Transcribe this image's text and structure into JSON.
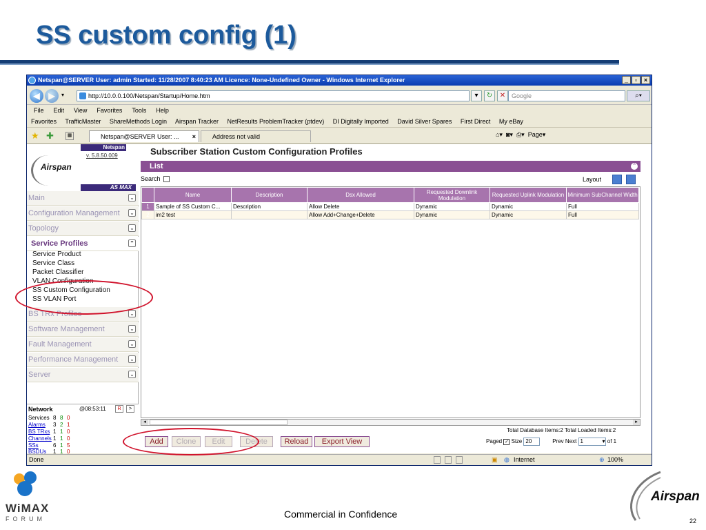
{
  "slide": {
    "title": "SS custom config (1)",
    "footer": "Commercial in Confidence",
    "page_number": "22",
    "wimax_logo_text": "WiMAX",
    "wimax_logo_sub": "FORUM",
    "airspan_logo_text": "Airspan"
  },
  "browser": {
    "title": "Netspan@SERVER User: admin Started: 11/28/2007 8:40:23 AM Licence: None-Undefined Owner - Windows Internet Explorer",
    "window_buttons": [
      "_",
      "▫",
      "×"
    ],
    "url": "http://10.0.0.100/Netspan/Startup/Home.htm",
    "search_placeholder": "Google",
    "menu": [
      "File",
      "Edit",
      "View",
      "Favorites",
      "Tools",
      "Help"
    ],
    "favorites": [
      "Favorites",
      "TrafficMaster",
      "ShareMethods Login",
      "Airspan Tracker",
      "NetResults ProblemTracker (ptdev)",
      "DI Digitally Imported",
      "David Silver Spares",
      "First Direct",
      "My eBay"
    ],
    "tabs": [
      "Netspan@SERVER User: ...",
      "Address not valid"
    ],
    "tools": [
      "Page"
    ],
    "status": {
      "left": "Done",
      "zone": "Internet",
      "zoom": "100%"
    }
  },
  "sidebar": {
    "badge": "Netspan",
    "version": "v. 5.8.50.009",
    "logo": "Airspan",
    "wimax": "AS MAX",
    "sections_top": [
      "Main",
      "Configuration Management",
      "Topology"
    ],
    "service_head": "Service Profiles",
    "service_items": [
      "Service Product",
      "Service Class",
      "Packet Classifier",
      "VLAN Configuration",
      "SS Custom Configuration",
      "SS VLAN Port"
    ],
    "sections_bottom": [
      "BS TRx Profiles",
      "Software Management",
      "Fault Management",
      "Performance Management",
      "Server"
    ],
    "network": {
      "title": "Network",
      "time": "@08:53:11",
      "btn_r": "R",
      "btn_next": ">",
      "rows": [
        {
          "label": "Services",
          "a": "8",
          "b": "8",
          "c": "0"
        },
        {
          "label": "Alarms",
          "a": "3",
          "b": "2",
          "c": "1"
        },
        {
          "label": "BS TRxs",
          "a": "1",
          "b": "1",
          "c": "0"
        },
        {
          "label": "Channels",
          "a": "1",
          "b": "1",
          "c": "0"
        },
        {
          "label": "SSs",
          "a": "6",
          "b": "1",
          "c": "5"
        },
        {
          "label": "BSDUs",
          "a": "1",
          "b": "1",
          "c": "0"
        }
      ]
    }
  },
  "main": {
    "title": "Subscriber Station Custom Configuration Profiles",
    "list_label": "List",
    "search_label": "Search",
    "layout_label": "Layout",
    "columns": [
      "Name",
      "Description",
      "Dsx Allowed",
      "Requested Downlink Modulation",
      "Requested Uplink Modulation",
      "Minimum SubChannel Width"
    ],
    "rows": [
      {
        "n": "1",
        "cells": [
          "Sample of SS Custom C...",
          "Description",
          "Allow Delete",
          "Dynamic",
          "Dynamic",
          "Full"
        ]
      },
      {
        "n": "2",
        "cells": [
          "im2 test",
          "",
          "Allow Add+Change+Delete",
          "Dynamic",
          "Dynamic",
          "Full"
        ]
      }
    ],
    "totals": "Total Database Items:2  Total Loaded Items:2",
    "buttons": {
      "add": "Add",
      "clone": "Clone",
      "edit": "Edit",
      "delete": "Delete",
      "reload": "Reload",
      "export": "Export View"
    },
    "paging": {
      "paged": "Paged",
      "size_label": "Size",
      "size": "20",
      "prevnext": "Prev Next",
      "page": "1",
      "of": "of 1"
    }
  },
  "colors": {
    "accent": "#8a4f93",
    "header": "#a774ad",
    "title": "#1c5a9c",
    "highlight_ring": "#d0122b"
  }
}
